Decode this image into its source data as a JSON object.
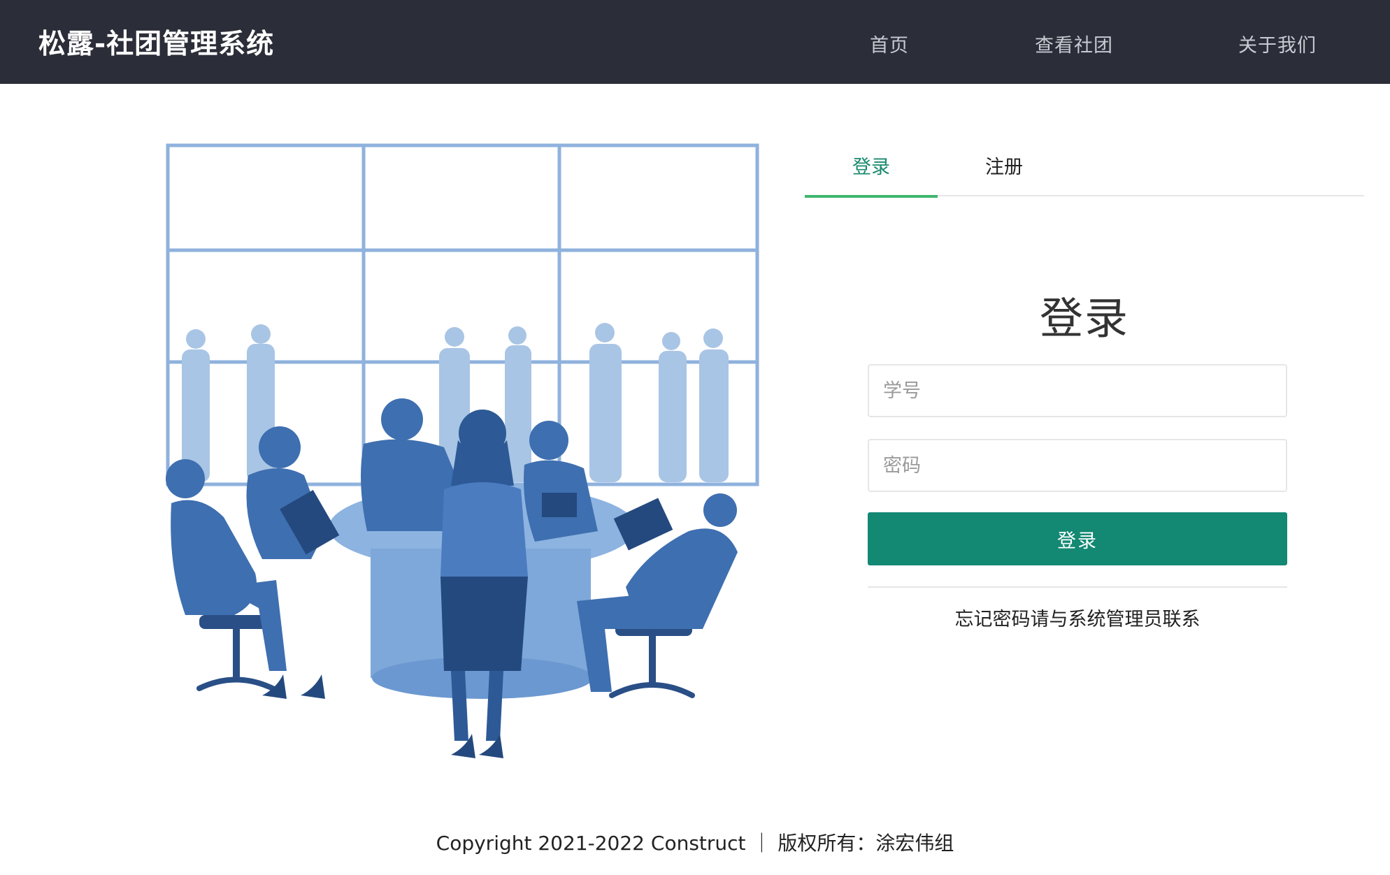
{
  "header": {
    "brand": "松露-社团管理系统",
    "nav": {
      "home": "首页",
      "clubs": "查看社团",
      "about": "关于我们"
    }
  },
  "tabs": {
    "login": "登录",
    "register": "注册"
  },
  "form": {
    "title": "登录",
    "student_id_placeholder": "学号",
    "password_placeholder": "密码",
    "submit_label": "登录",
    "forgot_text": "忘记密码请与系统管理员联系"
  },
  "footer": {
    "text": "Copyright 2021-2022 Construct ｜ 版权所有：涂宏伟组"
  },
  "colors": {
    "navbar_bg": "#2b2d38",
    "accent_green": "#138873",
    "tab_active": "#1a8a6e",
    "tab_underline": "#3fb76f",
    "illustration_blue": "#3e6fb0"
  },
  "illustration": {
    "icon": "team-meeting-illustration"
  }
}
